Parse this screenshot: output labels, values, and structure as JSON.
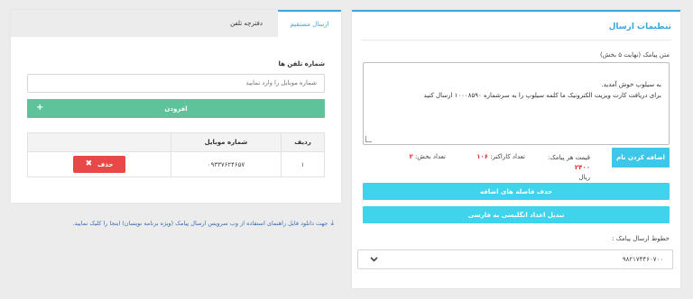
{
  "settings": {
    "title": "تنظیمات ارسال",
    "sms_label": "متن پیامک (نهایت ۵ بخش)",
    "sms_text": "به سیلوپ خوش آمدید.\nبرای دریافت کارت ویزیت الکترونیک ما کلمه سیلوپ را به سرشماره ۱۰۰۰۸۵۹۰ ارسال کنید",
    "add_name_button": "اضافه کردن نام",
    "price_label": "قیمت هر پیامک:",
    "price_value": "۲۴۰۰",
    "price_unit": "ریال",
    "chars_label": "تعداد کاراکتر:",
    "chars_value": "۱۰۶",
    "parts_label": "تعداد بخش:",
    "parts_value": "۲",
    "remove_spaces_button": "حذف فاصله های اضافه",
    "convert_digits_button": "تبدیل اعداد انگلیسی به فارسی",
    "line_label": "خطوط ارسال پیامک :",
    "line_value": "۹۸۲۱۷۴۴۶۰۷۰۰"
  },
  "direct": {
    "tabs": [
      "ارسال مستقیم",
      "دفترچه تلفن"
    ],
    "phones_label": "شماره تلفن ها",
    "phone_placeholder": "شماره موبایل را وارد نمایید",
    "add_button": "افزودن",
    "table": {
      "headers": [
        "ردیف",
        "شماره موبایل",
        ""
      ],
      "rows": [
        {
          "index": "۱",
          "mobile": "۰۹۳۳۷۶۲۴۶۵۷",
          "action": "حذف"
        }
      ]
    }
  },
  "download_note": "جهت دانلود فایل راهنمای استفاده از وب سرویس ارسال پیامک (ویژه برنامه نویسان) اینجا را کلیک نمایید.",
  "colors": {
    "accent": "#3aa6e0",
    "cyan_button": "#3fd3ec",
    "green_button": "#5ec29a",
    "danger": "#e84848",
    "stat_value": "#e12d2d"
  }
}
